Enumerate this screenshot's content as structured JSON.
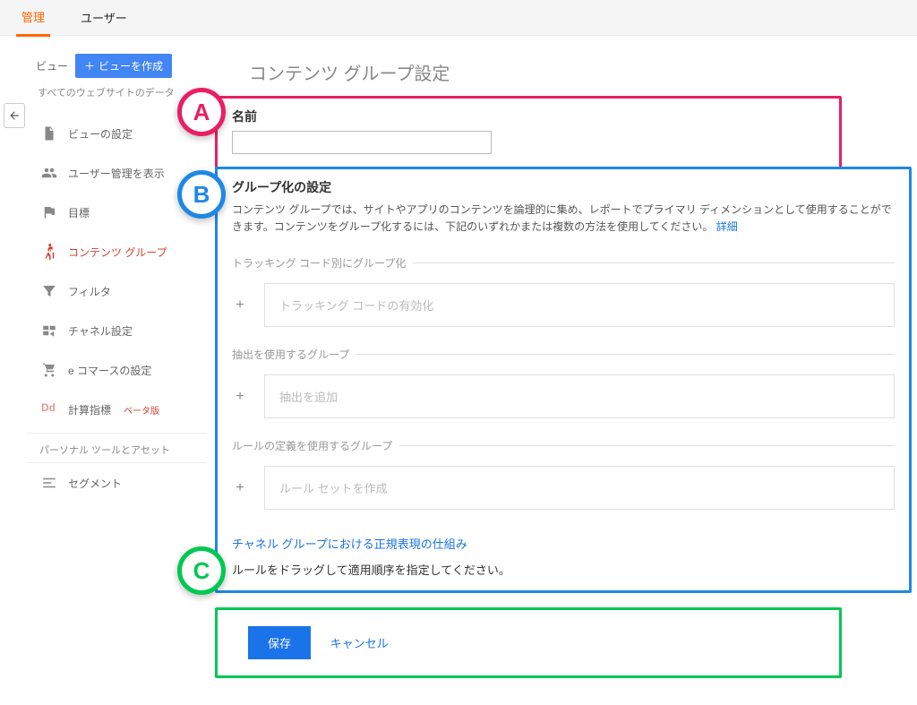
{
  "topnav": {
    "admin": "管理",
    "user": "ユーザー"
  },
  "sidebar": {
    "view": "ビュー",
    "createView": "ビューを作成",
    "allData": "すべてのウェブサイトのデータ",
    "items": [
      {
        "label": "ビューの設定"
      },
      {
        "label": "ユーザー管理を表示"
      },
      {
        "label": "目標"
      },
      {
        "label": "コンテンツ グループ"
      },
      {
        "label": "フィルタ"
      },
      {
        "label": "チャネル設定"
      },
      {
        "label": "e コマースの設定"
      },
      {
        "label": "計算指標",
        "beta": "ベータ版"
      }
    ],
    "personal": "パーソナル ツールとアセット",
    "segments": "セグメント"
  },
  "main": {
    "title": "コンテンツ グループ設定",
    "nameLabel": "名前",
    "groupSettingsTitle": "グループ化の設定",
    "groupDesc": "コンテンツ グループでは、サイトやアプリのコンテンツを論理的に集め、レポートでプライマリ ディメンションとして使用することができます。コンテンツをグループ化するには、下記のいずれかまたは複数の方法を使用してください。",
    "detailsLink": "詳細",
    "sections": {
      "byTracking": {
        "title": "トラッキング コード別にグループ化",
        "add": "トラッキング コードの有効化"
      },
      "byExtract": {
        "title": "抽出を使用するグループ",
        "add": "抽出を追加"
      },
      "byRules": {
        "title": "ルールの定義を使用するグループ",
        "add": "ルール セットを作成"
      }
    },
    "regexLink": "チャネル グループにおける正規表現の仕組み",
    "dragNote": "ルールをドラッグして適用順序を指定してください。",
    "save": "保存",
    "cancel": "キャンセル"
  },
  "bubbles": {
    "a": "A",
    "b": "B",
    "c": "C"
  }
}
